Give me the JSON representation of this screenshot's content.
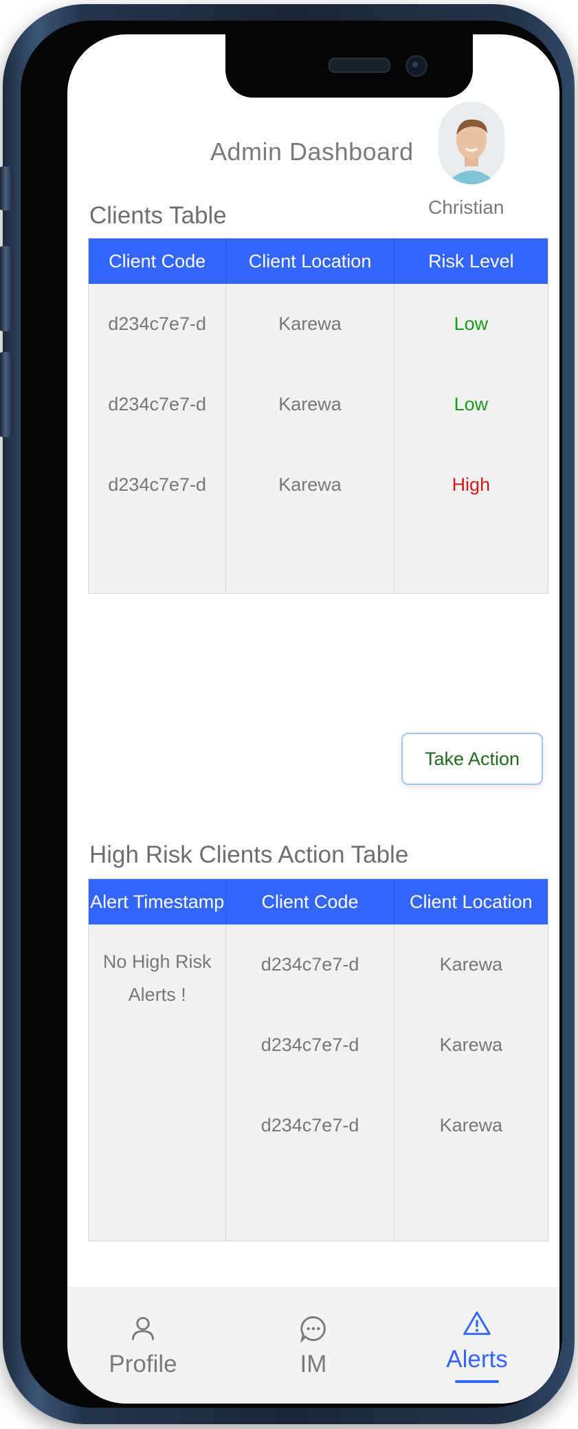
{
  "header": {
    "title": "Admin Dashboard",
    "user_name": "Christian"
  },
  "clients_table": {
    "title": "Clients Table",
    "columns": [
      "Client Code",
      "Client Location",
      "Risk Level"
    ],
    "rows": [
      {
        "code": "d234c7e7-d",
        "location": "Karewa",
        "risk": "Low"
      },
      {
        "code": "d234c7e7-d",
        "location": "Karewa",
        "risk": "Low"
      },
      {
        "code": "d234c7e7-d",
        "location": "Karewa",
        "risk": "High"
      }
    ]
  },
  "take_action_label": "Take Action",
  "high_risk_table": {
    "title": "High Risk Clients Action Table",
    "columns": [
      "Alert Timestamp",
      "Client Code",
      "Client Location"
    ],
    "empty_message_line1": "No High Risk",
    "empty_message_line2": "Alerts !",
    "rows": [
      {
        "code": "d234c7e7-d",
        "location": "Karewa"
      },
      {
        "code": "d234c7e7-d",
        "location": "Karewa"
      },
      {
        "code": "d234c7e7-d",
        "location": "Karewa"
      }
    ]
  },
  "tabs": [
    {
      "label": "Profile",
      "icon": "person-icon"
    },
    {
      "label": "IM",
      "icon": "chat-icon"
    },
    {
      "label": "Alerts",
      "icon": "warning-icon",
      "active": true
    }
  ],
  "colors": {
    "accent": "#3366ff",
    "low": "#1a9a1a",
    "high": "#d11a1a",
    "action_text": "#1e6b1e"
  }
}
